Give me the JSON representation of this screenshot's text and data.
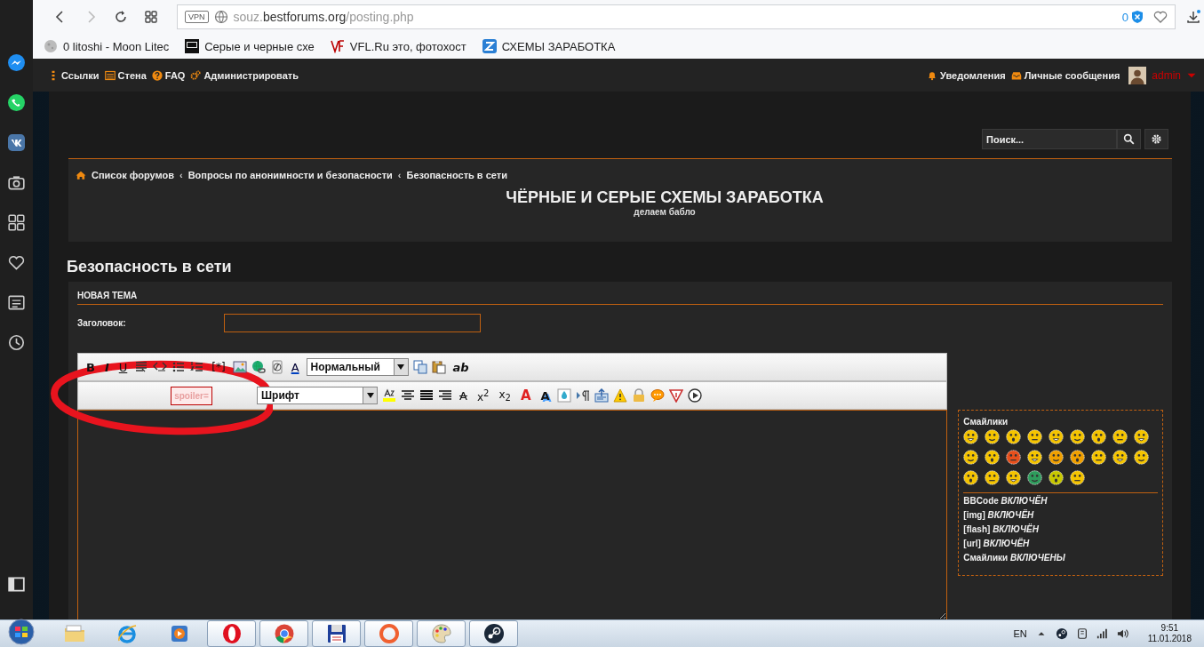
{
  "browser": {
    "url": {
      "prefix": "souz.",
      "host": "bestforums.org",
      "path": "/posting.php"
    },
    "vpn_label": "VPN",
    "shield_count": "0",
    "bookmarks": [
      {
        "kind": "moon",
        "label": "0 litoshi - Moon Litec"
      },
      {
        "kind": "square",
        "label": "Серые и черные схе"
      },
      {
        "kind": "vf",
        "label": "VFL.Ru это, фотохост"
      },
      {
        "kind": "z",
        "label": "СХЕМЫ ЗАРАБОТКА"
      }
    ]
  },
  "forum_nav": {
    "left": [
      {
        "kind": "links",
        "label": "Ссылки"
      },
      {
        "kind": "wall",
        "label": "Стена"
      },
      {
        "kind": "help",
        "label": "FAQ"
      },
      {
        "kind": "gear",
        "label": "Администрировать"
      }
    ],
    "right": [
      {
        "kind": "bell",
        "label": "Уведомления"
      },
      {
        "kind": "inbox",
        "label": "Личные сообщения"
      }
    ],
    "user": "admin"
  },
  "search": {
    "placeholder": "Поиск..."
  },
  "breadcrumbs": [
    {
      "label": "Список форумов"
    },
    {
      "separator": "‹",
      "label": "Вопросы по анонимности и безопасности"
    },
    {
      "separator": "‹",
      "label": "Безопасность в сети"
    }
  ],
  "site_title": "ЧЁРНЫЕ И СЕРЫЕ СХЕМЫ ЗАРАБОТКА",
  "site_subtitle": "делаем бабло",
  "page_title": "Безопасность в сети",
  "form": {
    "heading": "НОВАЯ ТЕМА",
    "subject_label": "Заголовок:"
  },
  "toolbar_rows": [
    [
      {
        "kind": "bold",
        "label": "B"
      },
      {
        "kind": "italic",
        "label": "I"
      },
      {
        "kind": "underline",
        "label": "U"
      },
      {
        "kind": "quote"
      },
      {
        "kind": "code"
      },
      {
        "kind": "list"
      },
      {
        "kind": "olist"
      },
      {
        "kind": "plain",
        "label": "[*]"
      },
      {
        "kind": "image"
      },
      {
        "kind": "link"
      },
      {
        "kind": "flash"
      },
      {
        "kind": "colorletter",
        "label": "A"
      },
      {
        "kind": "select",
        "value": "Нормальный"
      },
      {
        "kind": "copy"
      },
      {
        "kind": "paste"
      },
      {
        "kind": "italic",
        "label": "ab"
      }
    ],
    [
      {
        "kind": "tag",
        "label": "spoiler="
      },
      {
        "kind": "select",
        "value": "Шрифт"
      },
      {
        "kind": "highlight"
      },
      {
        "kind": "center"
      },
      {
        "kind": "justify"
      },
      {
        "kind": "right"
      },
      {
        "kind": "strike",
        "label": "A"
      },
      {
        "kind": "plain",
        "label": "x$^{2}$"
      },
      {
        "kind": "plain",
        "label": "x$_{2}$"
      },
      {
        "kind": "redletter",
        "label": "A"
      },
      {
        "kind": "shadowletter",
        "label": "A"
      },
      {
        "kind": "drop"
      },
      {
        "kind": "rtl"
      },
      {
        "kind": "upload"
      },
      {
        "kind": "warning"
      },
      {
        "kind": "lock"
      },
      {
        "kind": "speech"
      },
      {
        "kind": "triangle"
      },
      {
        "kind": "play"
      }
    ]
  ],
  "smilies": {
    "title": "Смайлики",
    "items": [
      {
        "color": "#f5c400"
      },
      {
        "color": "#f5c400"
      },
      {
        "color": "#f5c400"
      },
      {
        "color": "#f5c400"
      },
      {
        "color": "#f5c400"
      },
      {
        "color": "#f5c400"
      },
      {
        "color": "#f5c400"
      },
      {
        "color": "#f5c400"
      },
      {
        "color": "#f5c400"
      },
      {
        "color": "#f5c400"
      },
      {
        "color": "#f5c400"
      },
      {
        "color": "#e8501c"
      },
      {
        "color": "#f5c400"
      },
      {
        "color": "#f0a000"
      },
      {
        "color": "#f0a000"
      },
      {
        "color": "#f5c400"
      },
      {
        "color": "#f5c400"
      },
      {
        "color": "#f5c400"
      },
      {
        "color": "#f5c400"
      },
      {
        "color": "#f5c400"
      },
      {
        "color": "#f5c400"
      },
      {
        "color": "#2e9c5c"
      },
      {
        "color": "#c8c800"
      },
      {
        "color": "#f5c400"
      }
    ]
  },
  "status": [
    {
      "label": "BBCode",
      "value": "ВКЛЮЧЁН"
    },
    {
      "label": "[img]",
      "value": "ВКЛЮЧЁН"
    },
    {
      "label": "[flash]",
      "value": "ВКЛЮЧЁН"
    },
    {
      "label": "[url]",
      "value": "ВКЛЮЧЁН"
    },
    {
      "label": "Смайлики",
      "value": "ВКЛЮЧЕНЫ"
    }
  ],
  "taskbar": {
    "apps": [
      {
        "kind": "folder",
        "selected": false
      },
      {
        "kind": "ie",
        "selected": false
      },
      {
        "kind": "media",
        "selected": false
      },
      {
        "kind": "opera",
        "selected": true
      },
      {
        "kind": "chrome",
        "selected": true
      },
      {
        "kind": "floppy",
        "selected": true
      },
      {
        "kind": "ring",
        "selected": true
      },
      {
        "kind": "paint",
        "selected": true
      },
      {
        "kind": "steam",
        "selected": true
      }
    ],
    "lang": "EN",
    "time": "9:51",
    "date": "11.01.2018"
  }
}
